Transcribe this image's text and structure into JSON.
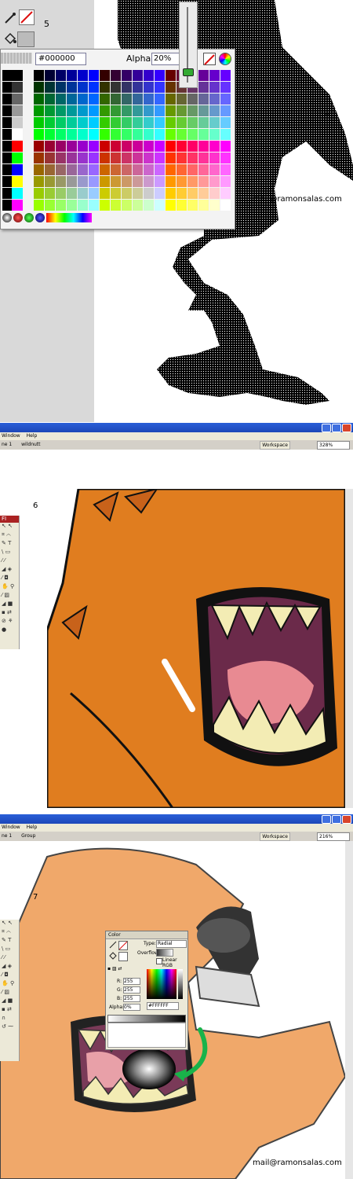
{
  "panel5": {
    "step": "5",
    "fill_hex_value": "#000000",
    "alpha_label": "Alpha:",
    "alpha_value": "20%",
    "watermark": "mail@ramonsalas.com",
    "cursor_glyph": "+",
    "fill_color": "#000000",
    "grayscale": [
      "#000000",
      "#333333",
      "#666666",
      "#999999",
      "#cccccc",
      "#ffffff",
      "#ff0000",
      "#00ff00",
      "#0000ff",
      "#ffff00",
      "#00ffff",
      "#ff00ff"
    ]
  },
  "panel6": {
    "step": "6",
    "menu": [
      "Window",
      "Help"
    ],
    "tabs": [
      "ne 1",
      "wildnutt"
    ],
    "workspace_label": "Workspace",
    "zoom": "328%",
    "tools_header": "FI"
  },
  "panel7": {
    "step": "7",
    "menu": [
      "Window",
      "Help"
    ],
    "tabs": [
      "ne 1",
      "Group"
    ],
    "workspace_label": "Workspace",
    "zoom": "216%",
    "color_panel": {
      "title": "Color",
      "type_label": "Type:",
      "type_value": "Radial",
      "overflow_label": "Overflow:",
      "linear_rgb_label": "Linear RGB",
      "r_label": "R:",
      "r_value": "255",
      "g_label": "G:",
      "g_value": "255",
      "b_label": "B:",
      "b_value": "255",
      "alpha_label": "Alpha:",
      "alpha_value": "0%",
      "hex_value": "#FFFFFF"
    },
    "watermark": "mail@ramonsalas.com"
  }
}
